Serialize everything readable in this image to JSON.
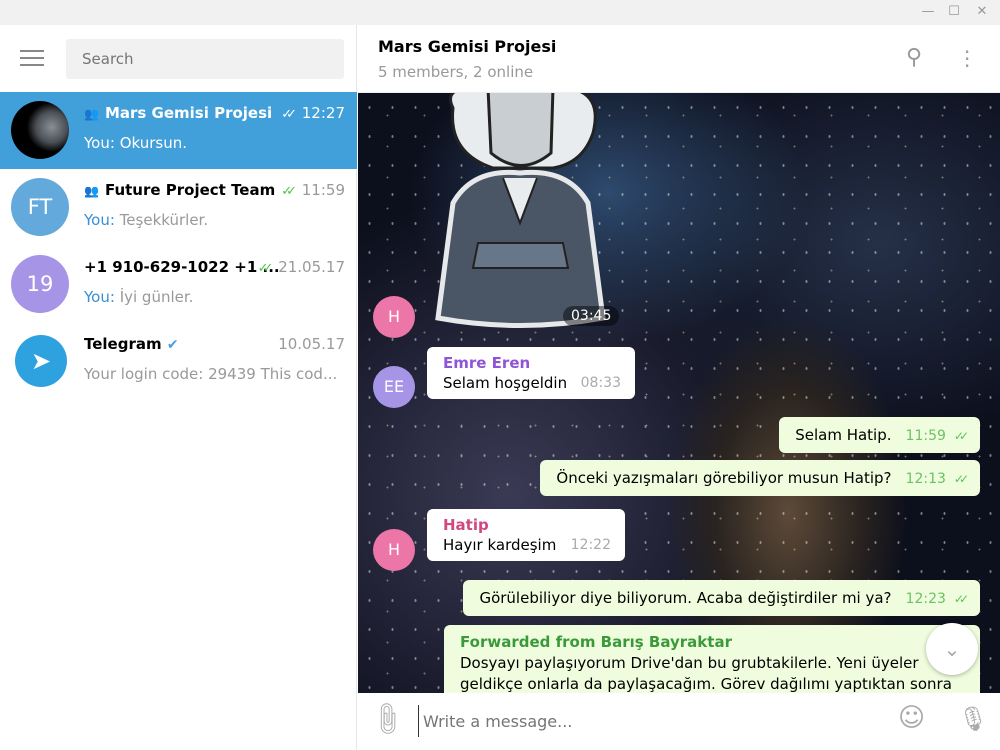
{
  "window": {
    "minimize": "—",
    "maximize": "☐",
    "close": "✕"
  },
  "search": {
    "placeholder": "Search"
  },
  "chats": [
    {
      "name": "Mars Gemisi Projesi",
      "time": "12:27",
      "prefix": "You:",
      "preview": " Okursun.",
      "group": true,
      "read": true
    },
    {
      "name": "Future Project Team",
      "time": "11:59",
      "prefix": "You:",
      "preview": " Teşekkürler.",
      "initials": "FT",
      "group": true,
      "read": true
    },
    {
      "name": "+1 910-629-1022 +1 ...",
      "time": "21.05.17",
      "prefix": "You:",
      "preview": " İyi günler.",
      "initials": "19",
      "read": true
    },
    {
      "name": "Telegram",
      "time": "10.05.17",
      "preview": "Your login code: 29439  This cod...",
      "verified": true
    }
  ],
  "header": {
    "title": "Mars Gemisi Projesi",
    "subtitle": "5 members, 2 online"
  },
  "messages": [
    {
      "type": "sticker",
      "avatar": "H",
      "time": "03:45"
    },
    {
      "sender": "Emre Eren",
      "avatar": "EE",
      "text": "Selam hoşgeldin",
      "time": "08:33"
    },
    {
      "out": true,
      "text": "Selam Hatip.",
      "time": "11:59"
    },
    {
      "out": true,
      "text": "Önceki yazışmaları görebiliyor musun Hatip?",
      "time": "12:13"
    },
    {
      "sender": "Hatip",
      "avatar": "H",
      "text": "Hayır kardeşim",
      "time": "12:22"
    },
    {
      "out": true,
      "text": "Görülebiliyor diye biliyorum. Acaba değiştirdiler mi ya?",
      "time": "12:23"
    },
    {
      "out": true,
      "forwarded": "Forwarded from Barış Bayraktar",
      "line1": "Dosyayı paylaşıyorum Drive'dan bu grubtakilerle. Yeni üyeler",
      "line2": "geldikçe onlarla da paylaşacağım. Görev dağılımı yaptıktan sonra"
    }
  ],
  "composer": {
    "placeholder": "Write a message..."
  },
  "colors": {
    "accent": "#419fd9",
    "outgoing": "#effdde",
    "green": "#4dc34f"
  }
}
